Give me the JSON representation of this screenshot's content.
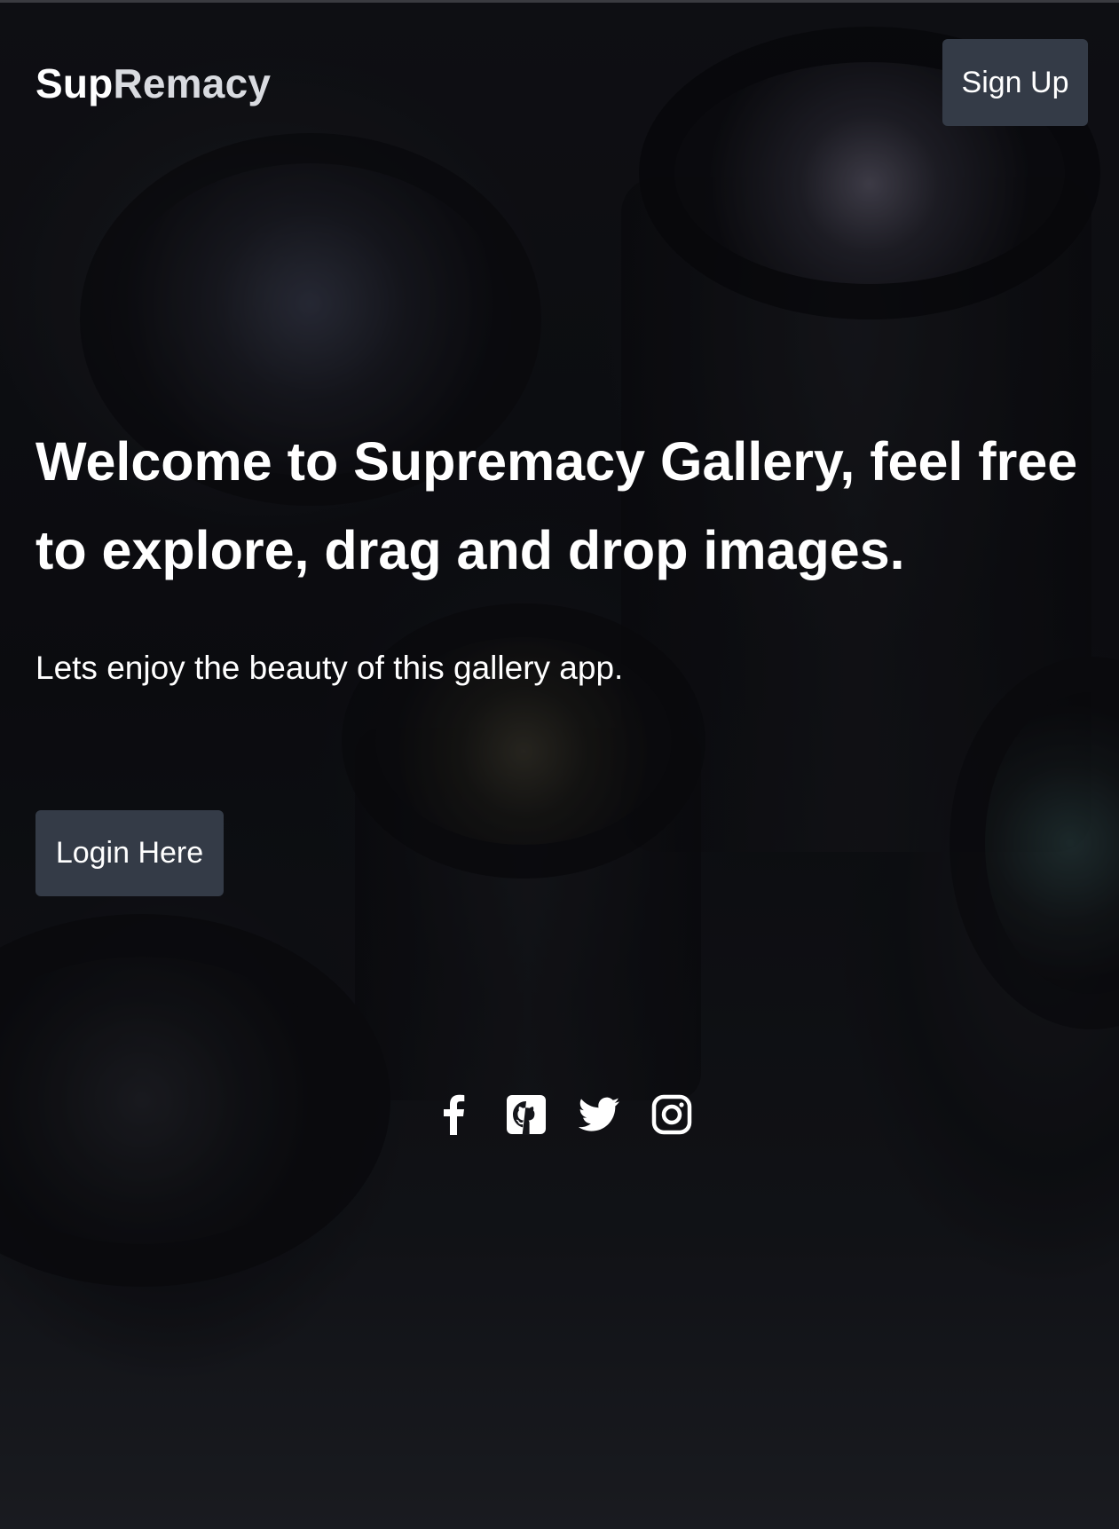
{
  "header": {
    "brand_part1": "Sup",
    "brand_part2": "Remacy",
    "signup_label": "Sign Up"
  },
  "hero": {
    "title": "Welcome to Supremacy Gallery, feel free to explore, drag and drop images.",
    "subtitle": "Lets enjoy the beauty of this gallery app.",
    "login_label": "Login Here"
  },
  "socials": [
    {
      "name": "facebook",
      "icon": "facebook-icon"
    },
    {
      "name": "github",
      "icon": "github-icon"
    },
    {
      "name": "twitter",
      "icon": "twitter-icon"
    },
    {
      "name": "instagram",
      "icon": "instagram-icon"
    }
  ],
  "colors": {
    "button_bg": "#343b47",
    "text": "#ffffff",
    "brand_secondary": "#d9dbe0"
  }
}
